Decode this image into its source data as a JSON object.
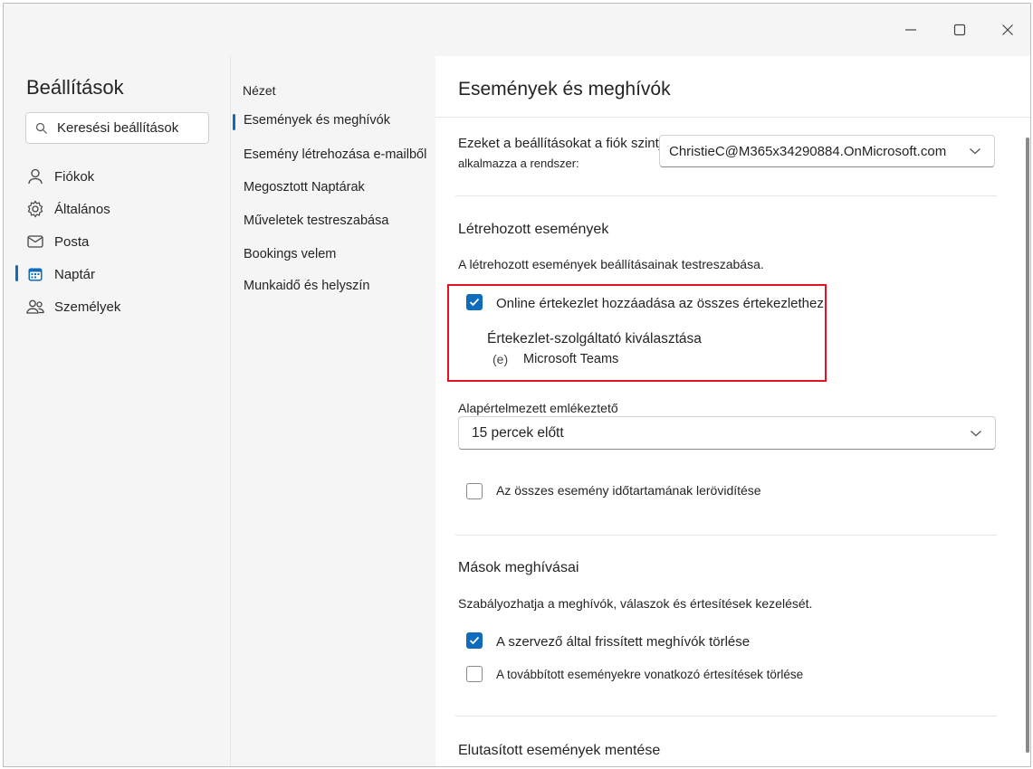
{
  "window": {
    "controls": {
      "minimize": "minimize",
      "maximize": "maximize",
      "close": "close"
    }
  },
  "settings": {
    "title": "Beállítások",
    "search_placeholder": "Keresési beállítások",
    "categories": [
      {
        "label": "Fiókok",
        "icon": "person-icon"
      },
      {
        "label": "Általános",
        "icon": "gear-icon"
      },
      {
        "label": "Posta",
        "icon": "mail-icon"
      },
      {
        "label": "Naptár",
        "icon": "calendar-icon",
        "selected": true
      },
      {
        "label": "Személyek",
        "icon": "people-icon"
      }
    ]
  },
  "nav": {
    "heading": "Nézet",
    "items": [
      {
        "label": "Események és meghívók",
        "selected": true
      },
      {
        "label": "Esemény létrehozása e-mailből"
      },
      {
        "label": "Megosztott Naptárak"
      },
      {
        "label": "Műveletek testreszabása"
      },
      {
        "label": "Bookings velem"
      },
      {
        "label": "Munkaidő és helyszín"
      }
    ]
  },
  "main": {
    "title": "Események és meghívók",
    "account_label_line1": "Ezeket a beállításokat a fiók szintjén",
    "account_label_line2": "alkalmazza a rendszer:",
    "account_value": "ChristieC@M365x34290884.OnMicrosoft.com",
    "created_events": {
      "heading": "Létrehozott események",
      "description": "A létrehozott események beállításainak testreszabása.",
      "online_meeting_label": "Online értekezlet hozzáadása az összes értekezlethez",
      "online_meeting_checked": true,
      "provider_heading": "Értekezlet-szolgáltató kiválasztása",
      "provider_marker": "(e)",
      "provider_value": "Microsoft Teams",
      "reminder_label": "Alapértelmezett emlékeztető",
      "reminder_value": "15 percek előtt",
      "shorten_label": "Az összes esemény időtartamának lerövidítése",
      "shorten_checked": false
    },
    "others_invites": {
      "heading": "Mások meghívásai",
      "description": "Szabályozhatja a meghívók, válaszok és értesítések kezelését.",
      "delete_updated_label": "A szervező által frissített meghívók törlése",
      "delete_updated_checked": true,
      "delete_forwarded_label": "A továbbított eseményekre vonatkozó értesítések törlése",
      "delete_forwarded_checked": false
    },
    "declined": {
      "heading": "Elutasított események mentése"
    }
  },
  "colors": {
    "accent": "#0f6cbd",
    "highlight_box": "#e81123"
  }
}
